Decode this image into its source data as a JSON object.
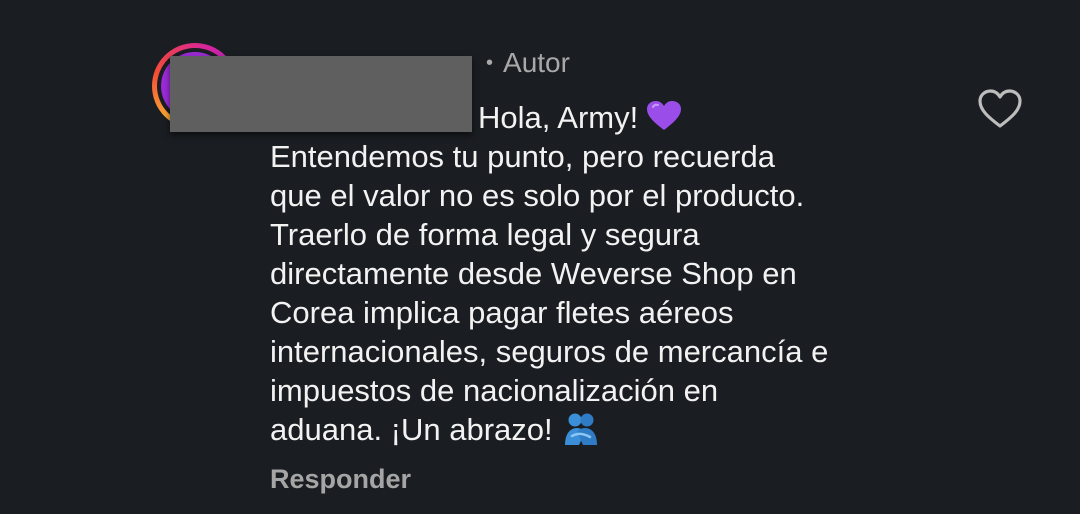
{
  "comment": {
    "author_role": "Autor",
    "separator": "•",
    "lines": [
      "Hola, Army!",
      "Entendemos tu punto, pero recuerda",
      "que el valor no es solo por el producto.",
      "Traerlo de forma legal y segura",
      "directamente desde Weverse Shop en",
      "Corea implica pagar fletes aéreos",
      "internacionales, seguros de mercancía e",
      "impuestos de nacionalización en",
      "aduana. ¡Un abrazo!"
    ],
    "reply_label": "Responder"
  },
  "icons": {
    "inline_heart": "purple-heart-emoji",
    "hug": "people-hugging-emoji",
    "like": "heart-outline-icon",
    "avatar": "story-ring-avatar"
  },
  "colors": {
    "background": "#1a1d21",
    "text": "#f2f2f2",
    "muted": "#a8a8a8",
    "purple_heart": "#9b4dea",
    "hug_blue": "#3b8fd9",
    "redaction": "#5f5f5f"
  }
}
